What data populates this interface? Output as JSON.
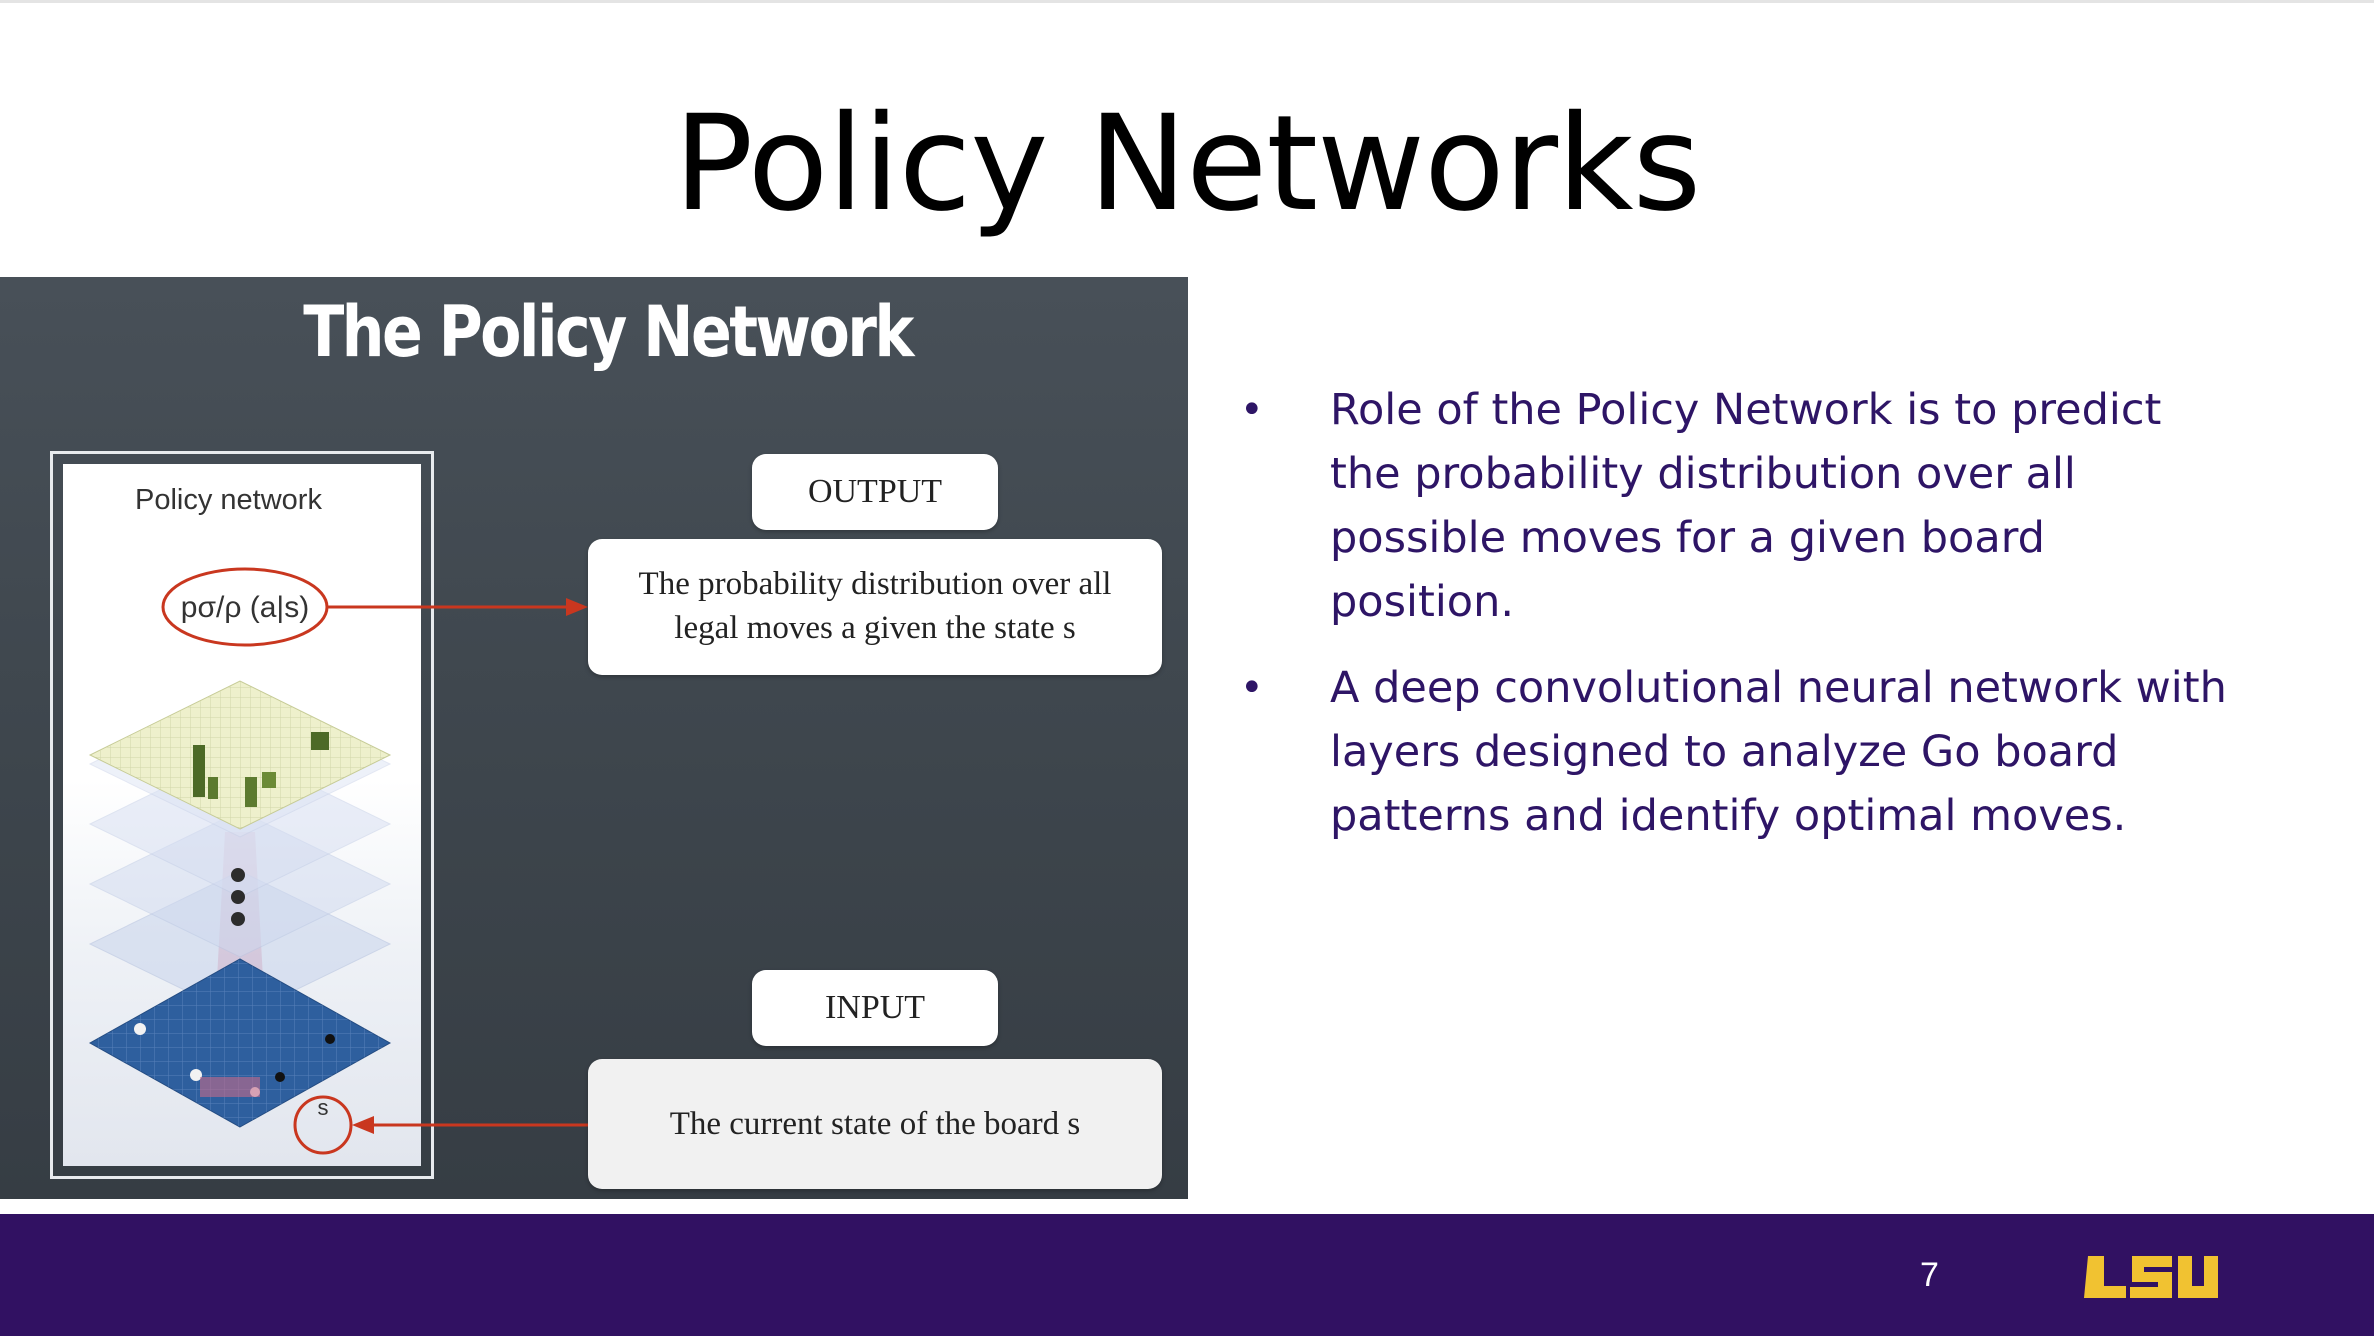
{
  "slide": {
    "title": "Policy Networks",
    "page_number": "7",
    "logo_text": "LSU"
  },
  "figure": {
    "title": "The Policy Network",
    "panel_label": "Policy network",
    "output_label": "OUTPUT",
    "output_desc_line1": "The probability distribution over all",
    "output_desc_line2": "legal moves  a  given the state  s",
    "input_label": "INPUT",
    "input_desc": "The current state of the board  s",
    "formula": "pσ/ρ (a|s)",
    "state_symbol": "s"
  },
  "bullets": [
    "Role of the Policy Network is to predict the probability distribution over all possible moves for a given board position.",
    "A deep convolutional neural network with layers designed to analyze Go board patterns and identify optimal moves."
  ],
  "colors": {
    "footer": "#311162",
    "bullet_text": "#2e1566",
    "logo_gold": "#f1c231",
    "arrow_red": "#c9371f"
  }
}
